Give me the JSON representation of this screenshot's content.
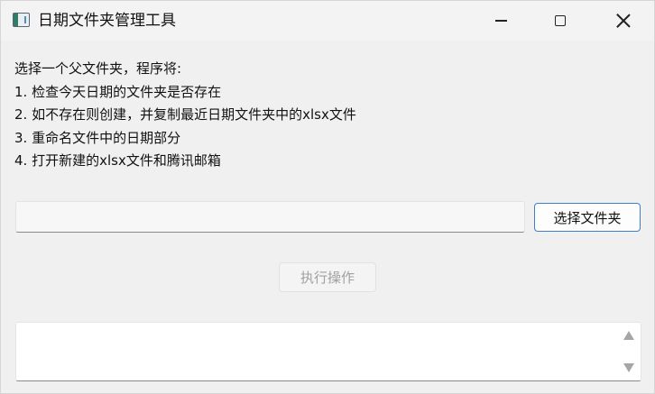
{
  "window": {
    "title": "日期文件夹管理工具",
    "icon": "folder-app-icon"
  },
  "instructions": {
    "lines": [
      "选择一个父文件夹，程序将:",
      "1. 检查今天日期的文件夹是否存在",
      "2. 如不存在则创建，并复制最近日期文件夹中的xlsx文件",
      "3. 重命名文件中的日期部分",
      "4. 打开新建的xlsx文件和腾讯邮箱"
    ]
  },
  "path_input": {
    "value": "",
    "placeholder": ""
  },
  "buttons": {
    "select_folder": "选择文件夹",
    "execute": "执行操作"
  },
  "log": {
    "text": ""
  },
  "colors": {
    "accent": "#3f7fc9",
    "window_bg": "#f0f0f0",
    "disabled_text": "#a0a0a0"
  }
}
